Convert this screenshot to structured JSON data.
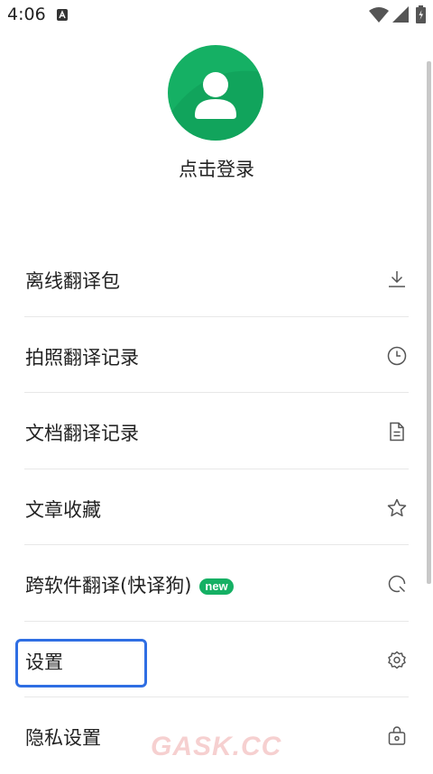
{
  "status_bar": {
    "time": "4:06",
    "notification_icon": "a-square-icon",
    "wifi_icon": "wifi-icon",
    "signal_icon": "signal-icon",
    "battery_icon": "battery-icon"
  },
  "profile": {
    "avatar_icon": "user-avatar-icon",
    "avatar_color": "#15b064",
    "login_text": "点击登录"
  },
  "menu": {
    "items": [
      {
        "label": "离线翻译包",
        "icon": "download-icon"
      },
      {
        "label": "拍照翻译记录",
        "icon": "clock-icon"
      },
      {
        "label": "文档翻译记录",
        "icon": "document-icon"
      },
      {
        "label": "文章收藏",
        "icon": "star-icon"
      },
      {
        "label": "跨软件翻译(快译狗)",
        "icon": "search-circle-icon",
        "badge": "new"
      },
      {
        "label": "设置",
        "icon": "settings-icon",
        "highlighted": true
      },
      {
        "label": "隐私设置",
        "icon": "lock-bag-icon"
      }
    ]
  },
  "highlight_color": "#2f6ee3",
  "badge_color": "#15b064",
  "watermark": "GASK.CC"
}
